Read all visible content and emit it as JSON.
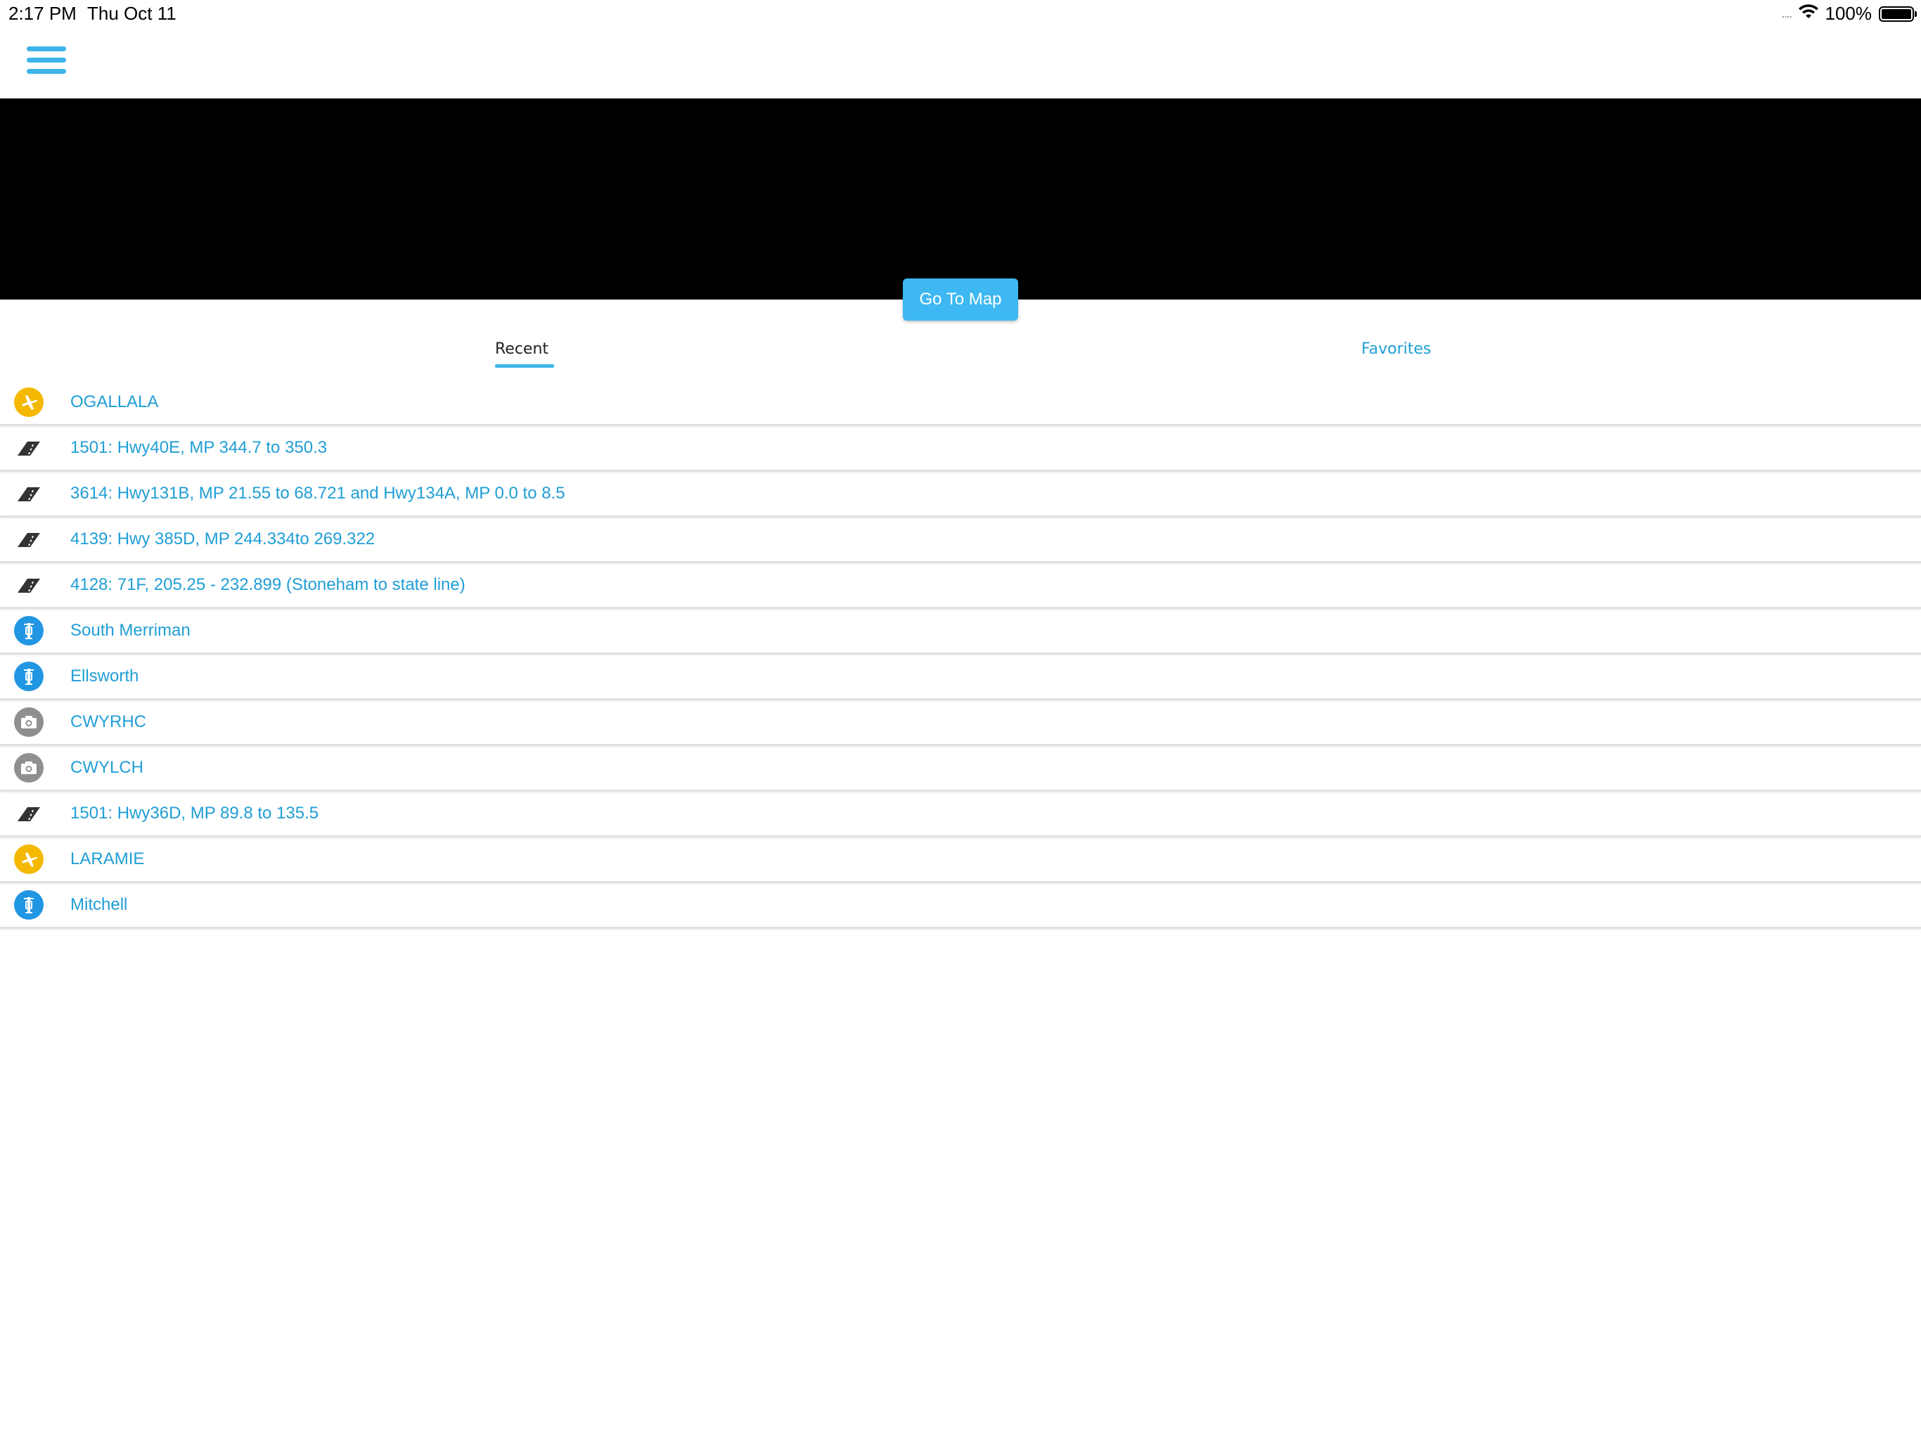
{
  "status_bar": {
    "time": "2:17 PM",
    "date": "Thu Oct 11",
    "signal": "....",
    "battery_percent": "100%",
    "battery_level": 1.0
  },
  "banner": {
    "go_to_map_label": "Go To Map"
  },
  "tabs": [
    {
      "label": "Recent",
      "active": true
    },
    {
      "label": "Favorites",
      "active": false
    }
  ],
  "colors": {
    "accent": "#3cb4ea",
    "link": "#1f9ed6",
    "airport": "#f5b800",
    "station": "#2196e3",
    "camera": "#8f8f8f"
  },
  "recent_items": [
    {
      "icon": "airport-icon",
      "label": "OGALLALA"
    },
    {
      "icon": "road-icon",
      "label": "1501: Hwy40E, MP 344.7 to 350.3"
    },
    {
      "icon": "road-icon",
      "label": "3614: Hwy131B, MP 21.55 to 68.721 and Hwy134A, MP 0.0 to 8.5"
    },
    {
      "icon": "road-icon",
      "label": "4139: Hwy 385D, MP 244.334to 269.322"
    },
    {
      "icon": "road-icon",
      "label": "4128: 71F, 205.25 - 232.899 (Stoneham to state line)"
    },
    {
      "icon": "weather-station-icon",
      "label": "South Merriman"
    },
    {
      "icon": "weather-station-icon",
      "label": "Ellsworth"
    },
    {
      "icon": "camera-icon",
      "label": "CWYRHC"
    },
    {
      "icon": "camera-icon",
      "label": "CWYLCH"
    },
    {
      "icon": "road-icon",
      "label": "1501: Hwy36D, MP 89.8 to 135.5"
    },
    {
      "icon": "airport-icon",
      "label": "LARAMIE"
    },
    {
      "icon": "weather-station-icon",
      "label": "Mitchell"
    }
  ]
}
